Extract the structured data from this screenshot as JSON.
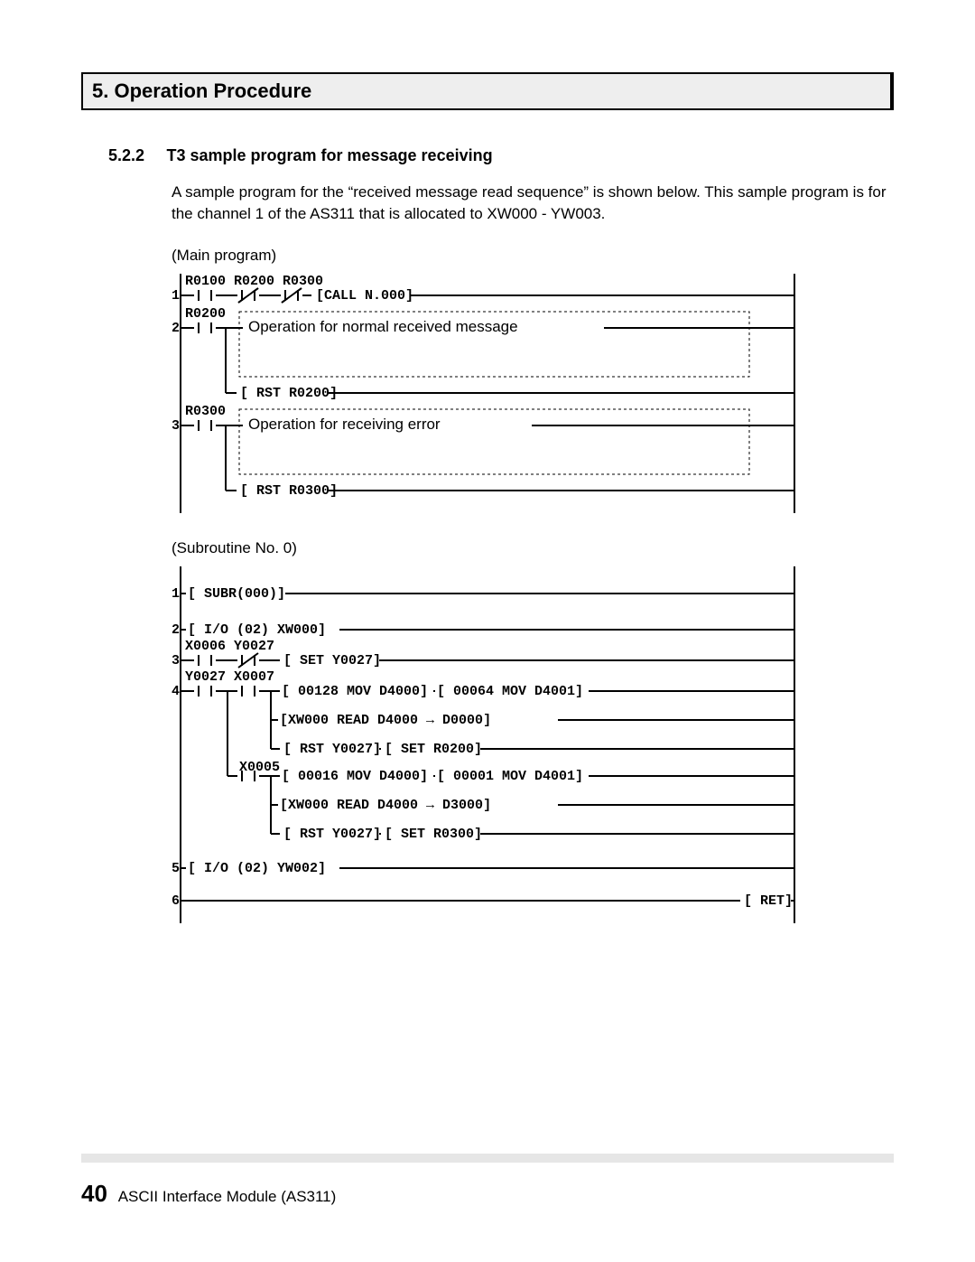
{
  "heading": "5. Operation Procedure",
  "subsection_num": "5.2.2",
  "subsection_title": "T3 sample program for message receiving",
  "para1": "A sample program for the “received message read sequence” is shown below. This sample program is for the channel 1 of the AS311 that is allocated to XW000 - YW003.",
  "main_label": "(Main program)",
  "sub_label": "(Subroutine No. 0)",
  "main_diagram": {
    "reg_top": "R0100 R0200 R0300",
    "r0200": "R0200",
    "r0300": "R0300",
    "call": "CALL N.000",
    "annot1": "Operation for normal received message",
    "rst1": "RST R0200",
    "annot2": "Operation for receiving error",
    "rst2": "RST R0300",
    "rung1": "1",
    "rung2": "2",
    "rung3": "3"
  },
  "sub_diagram": {
    "r1": "1",
    "r2": "2",
    "r3": "3",
    "r4": "4",
    "r5": "5",
    "r6": "6",
    "subr": "SUBR(000)",
    "io1": "I/O  (02) XW000",
    "regs1": "X0006 Y0027",
    "set1": "SET Y0027",
    "regs2": "Y0027 X0007",
    "mov1a": "00128 MOV D4000",
    "mov1b": "00064 MOV D4001",
    "read1": "XW000 READ  D4000   →   D0000",
    "rst_set1": "RST Y0027",
    "set_r0200": "SET R0200",
    "x0005": "X0005",
    "mov2a": "00016 MOV D4000",
    "mov2b": "00001 MOV D4001",
    "read2": "XW000 READ  D4000   →   D3000",
    "rst_set2": "RST Y0027",
    "set_r0300": "SET R0300",
    "io2": "I/O  (02) YW002",
    "ret": "RET"
  },
  "footer": {
    "page": "40",
    "doc": "ASCII Interface Module (AS311)"
  }
}
